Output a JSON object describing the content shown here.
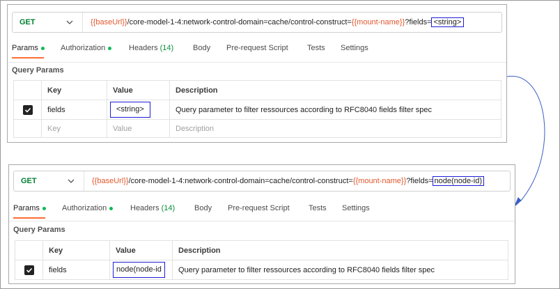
{
  "colors": {
    "method_get": "#007f31",
    "variable": "#e0572d",
    "highlight_box": "#1c1cd8",
    "active_tab_underline": "#ff6c37",
    "status_dot": "#0cbb52",
    "arrow": "#3a5fc4"
  },
  "icons": {
    "dropdown": "chevron-down-icon",
    "checkbox": "checkbox-checked-icon",
    "arrow": "curved-arrow-icon"
  },
  "top": {
    "method": "GET",
    "url": {
      "base_var": "{{baseUrl}}",
      "path": "/core-model-1-4:network-control-domain=cache/control-construct=",
      "mount_var": "{{mount-name}}",
      "query_prefix": "?fields=",
      "fields_value": "<string>"
    },
    "tabs": {
      "params": "Params",
      "authorization": "Authorization",
      "headers": "Headers",
      "headers_count": "(14)",
      "body": "Body",
      "prerequest": "Pre-request Script",
      "tests": "Tests",
      "settings": "Settings"
    },
    "query_params_title": "Query Params",
    "table": {
      "headers": {
        "key": "Key",
        "value": "Value",
        "description": "Description"
      },
      "row": {
        "key": "fields",
        "value": "<string>",
        "description": "Query parameter to filter ressources according to RFC8040 fields filter spec"
      },
      "placeholder": {
        "key": "Key",
        "value": "Value",
        "description": "Description"
      }
    }
  },
  "bottom": {
    "method": "GET",
    "url": {
      "base_var": "{{baseUrl}}",
      "path": "/core-model-1-4:network-control-domain=cache/control-construct=",
      "mount_var": "{{mount-name}}",
      "query_prefix": "?fields=",
      "fields_value": "node(node-id)"
    },
    "tabs": {
      "params": "Params",
      "authorization": "Authorization",
      "headers": "Headers",
      "headers_count": "(14)",
      "body": "Body",
      "prerequest": "Pre-request Script",
      "tests": "Tests",
      "settings": "Settings"
    },
    "query_params_title": "Query Params",
    "table": {
      "headers": {
        "key": "Key",
        "value": "Value",
        "description": "Description"
      },
      "row": {
        "key": "fields",
        "value": "node(node-id",
        "description": "Query parameter to filter ressources according to RFC8040 fields filter spec"
      }
    }
  }
}
